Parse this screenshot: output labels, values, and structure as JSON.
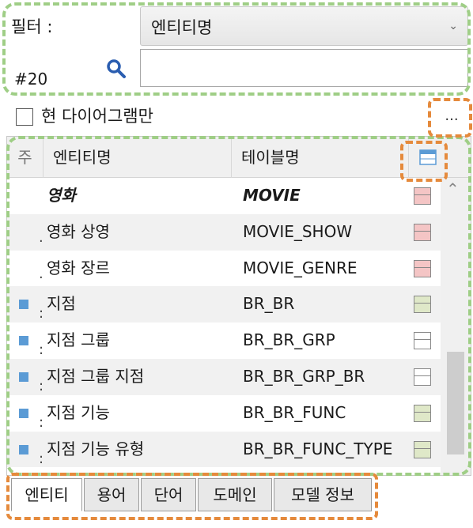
{
  "filter": {
    "label": "필터 :",
    "select_value": "엔티티명",
    "search_value": "",
    "count": "#20"
  },
  "checkbox": {
    "label": "현 다이어그램만",
    "checked": false
  },
  "ellipsis_label": "...",
  "grid": {
    "headers": {
      "subject": "주",
      "entity": "엔티티명",
      "table": "테이블명"
    },
    "rows": [
      {
        "subject": "",
        "entity": "영화",
        "table": "MOVIE",
        "bold": true,
        "icon_color": "#f4c5c5"
      },
      {
        "subject": "·",
        "entity": "영화 상영",
        "table": "MOVIE_SHOW",
        "bold": false,
        "icon_color": "#f4c5c5"
      },
      {
        "subject": "·",
        "entity": "영화 장르",
        "table": "MOVIE_GENRE",
        "bold": false,
        "icon_color": "#f4c5c5"
      },
      {
        "subject": ":",
        "entity": "지점",
        "table": "BR_BR",
        "bold": false,
        "icon_color": "#dfe8c8"
      },
      {
        "subject": ":",
        "entity": "지점 그룹",
        "table": "BR_BR_GRP",
        "bold": false,
        "icon_color": "#ffffff"
      },
      {
        "subject": ":",
        "entity": "지점 그룹 지점",
        "table": "BR_BR_GRP_BR",
        "bold": false,
        "icon_color": "#ffffff"
      },
      {
        "subject": ":",
        "entity": "지점 기능",
        "table": "BR_BR_FUNC",
        "bold": false,
        "icon_color": "#dfe8c8"
      },
      {
        "subject": ":",
        "entity": "지점 기능 유형",
        "table": "BR_BR_FUNC_TYPE",
        "bold": false,
        "icon_color": "#dfe8c8"
      }
    ]
  },
  "tabs": [
    {
      "label": "엔티티",
      "active": true
    },
    {
      "label": "용어",
      "active": false
    },
    {
      "label": "단어",
      "active": false
    },
    {
      "label": "도메인",
      "active": false
    },
    {
      "label": "모델 정보",
      "active": false
    }
  ],
  "colors": {
    "annotation_green": "#9fce86",
    "annotation_orange": "#e58a3c",
    "subject_square": "#5b9bd5",
    "search_icon": "#2a5db0"
  }
}
